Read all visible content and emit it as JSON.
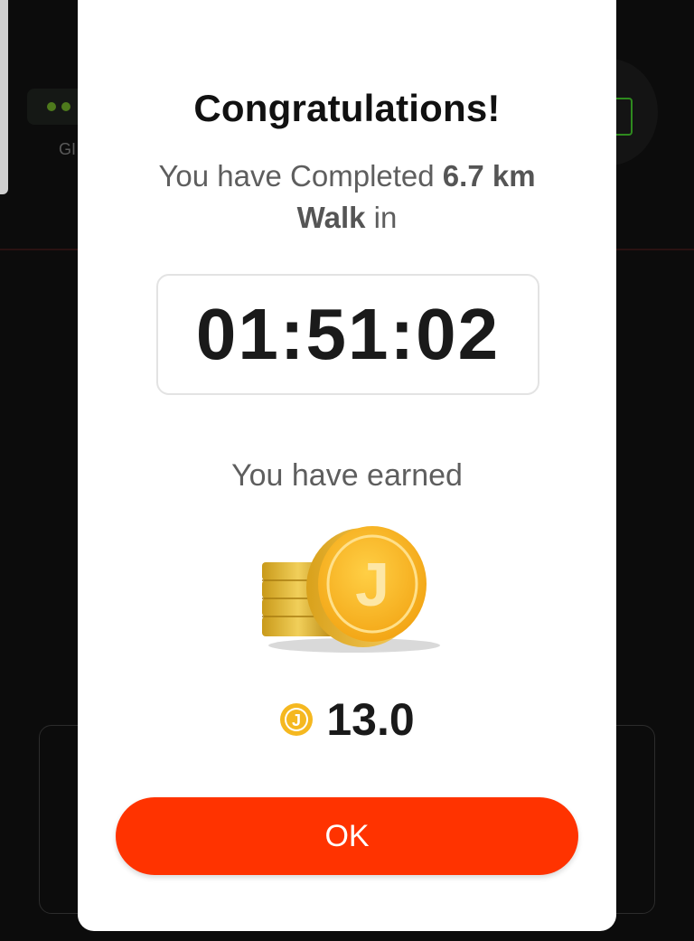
{
  "background": {
    "gps_label": "GI"
  },
  "dialog": {
    "title": "Congratulations!",
    "subtitle_prefix": "You have Completed ",
    "distance": "6.7 km",
    "activity": "Walk",
    "subtitle_suffix": " in",
    "duration": "01:51:02",
    "earned_label": "You have earned",
    "coin_letter": "J",
    "earned_amount": "13.0",
    "ok_label": "OK"
  },
  "colors": {
    "accent": "#ff3300",
    "coin_gold": "#f7b21f",
    "text_dark": "#111111",
    "text_muted": "#5e5e5e"
  },
  "icons": {
    "coins_stack": "coin-stack-icon",
    "coin_small": "coin-icon"
  }
}
